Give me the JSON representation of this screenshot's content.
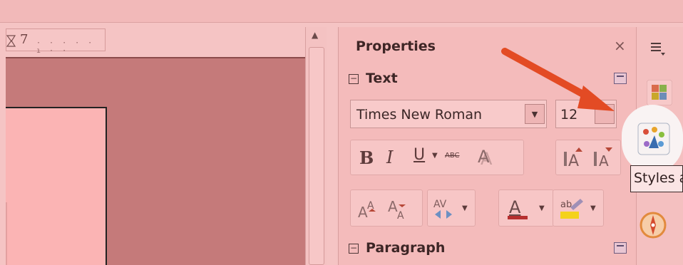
{
  "ruler": {
    "number": "7"
  },
  "sidebar": {
    "title": "Properties",
    "close_symbol": "×",
    "sections": [
      {
        "label": "Text"
      },
      {
        "label": "Paragraph"
      }
    ],
    "font_name": "Times New Roman",
    "font_size": "12",
    "buttons": {
      "bold": "B",
      "italic": "I",
      "underline": "U",
      "strikethrough": "ABC"
    }
  },
  "tooltip": {
    "text": "Styles a"
  },
  "colors": {
    "overlay": "#f5c4c4",
    "arrow": "#e34b24",
    "font_color_bar": "#b62f2f",
    "highlight_bar": "#f4d21c"
  }
}
